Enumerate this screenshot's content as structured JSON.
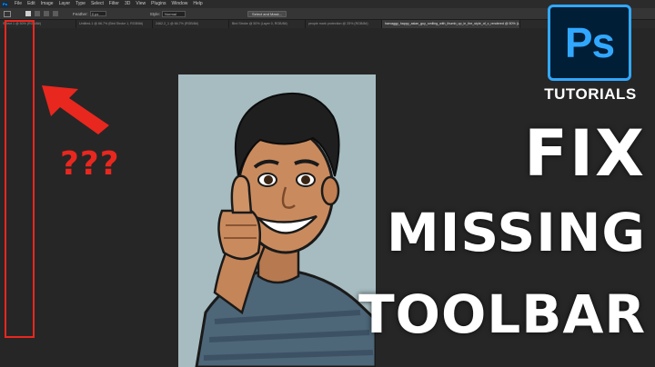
{
  "menubar": {
    "app_mark": "Ps",
    "items": [
      "File",
      "Edit",
      "Image",
      "Layer",
      "Type",
      "Select",
      "Filter",
      "3D",
      "View",
      "Plugins",
      "Window",
      "Help"
    ]
  },
  "options_bar": {
    "feather_label": "Feather:",
    "feather_value": "0 px",
    "style_label": "Style:",
    "style_value": "Normal",
    "select_mask_button": "Select and Mask..."
  },
  "document_tabs": [
    "Select 1 @ 50% (RGB/8#)",
    "Untitled-1 @ 66.7% (Bird Stroke 1, RGB/8#)",
    "2462.2_1 @ 66.7% (RGB/8#)",
    "Bird Stroke @ 50% (Layer 0, RGB/8#)",
    "people mark protection @ 25% (RGB/8#)",
    "harvaggy_happy_asian_guy_smiling_with_thumb_up_in_the_style_of_c_rendered @ 50% (Layer 0, RGB/8#)"
  ],
  "annotations": {
    "question_marks": "???",
    "accent_color": "#e8271f"
  },
  "branding": {
    "logo_text": "Ps",
    "logo_color": "#31a8ff",
    "subtitle": "TUTORIALS"
  },
  "headline": {
    "line1": "FIX",
    "line2": "MISSING",
    "line3": "TOOLBAR"
  }
}
